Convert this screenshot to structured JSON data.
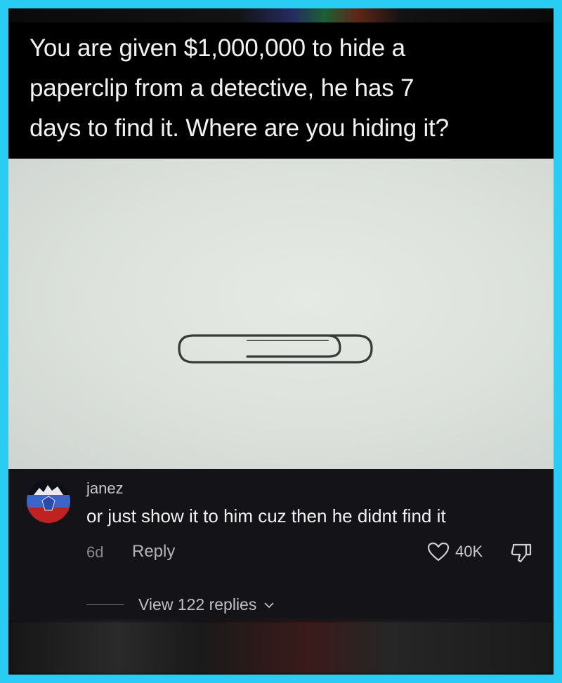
{
  "post": {
    "question_line1": "You are given $1,000,000 to hide a",
    "question_line2": "paperclip from a detective, he has 7",
    "question_line3": "days to find it. Where are you hiding it?"
  },
  "comment": {
    "username": "janez",
    "text": "or just show it to him cuz then he didnt find it",
    "time": "6d",
    "reply_label": "Reply",
    "like_count": "40K",
    "view_replies_label": "View 122 replies"
  },
  "icons": {
    "like": "heart-icon",
    "dislike": "thumbs-down-icon",
    "expand": "chevron-down-icon"
  },
  "colors": {
    "border": "#29cdf3",
    "background": "#000000",
    "comment_bg": "#141418"
  }
}
